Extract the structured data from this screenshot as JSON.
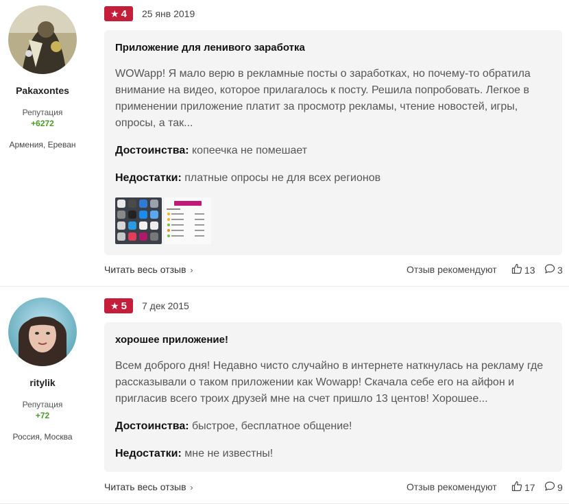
{
  "reviews": [
    {
      "author": {
        "name": "Pakaxontes",
        "reputation_label": "Репутация",
        "reputation": "+6272",
        "location": "Армения, Ереван"
      },
      "rating": "4",
      "date": "25 янв 2019",
      "title": "Приложение для ленивого заработка",
      "text": "WOWapp! Я мало верю в рекламные посты о заработках, но почему-то обратила внимание на видео, которое прилагалось к посту. Решила попробовать. Легкое в применении приложение платит за просмотр рекламы, чтение новостей, игры, опросы, а так...",
      "pros_label": "Достоинства:",
      "pros": "копеечка не помешает",
      "cons_label": "Недостатки:",
      "cons": "платные опросы не для всех регионов",
      "read_more": "Читать весь отзыв",
      "recommend_label": "Отзыв рекомендуют",
      "likes": "13",
      "comments": "3"
    },
    {
      "author": {
        "name": "ritylik",
        "reputation_label": "Репутация",
        "reputation": "+72",
        "location": "Россия, Москва"
      },
      "rating": "5",
      "date": "7 дек 2015",
      "title": "хорошее приложение!",
      "text": "Всем доброго дня! Недавно чисто случайно в интернете наткнулась на рекламу где рассказывали о таком приложении как Wowapp! Скачала себе его на айфон и пригласив всего троих друзей мне на счет пришло 13 центов! Хорошее...",
      "pros_label": "Достоинства:",
      "pros": "быстрое, бесплатное общение!",
      "cons_label": "Недостатки:",
      "cons": "мне не известны!",
      "read_more": "Читать весь отзыв",
      "recommend_label": "Отзыв рекомендуют",
      "likes": "17",
      "comments": "9"
    }
  ],
  "icons": {
    "star": "star-icon",
    "chevron": "chevron-right-icon",
    "like": "thumbs-up-icon",
    "comment": "comment-icon"
  },
  "colors": {
    "badge": "#c41e3a",
    "reputation": "#4a9a2a",
    "card": "#f4f4f4"
  }
}
